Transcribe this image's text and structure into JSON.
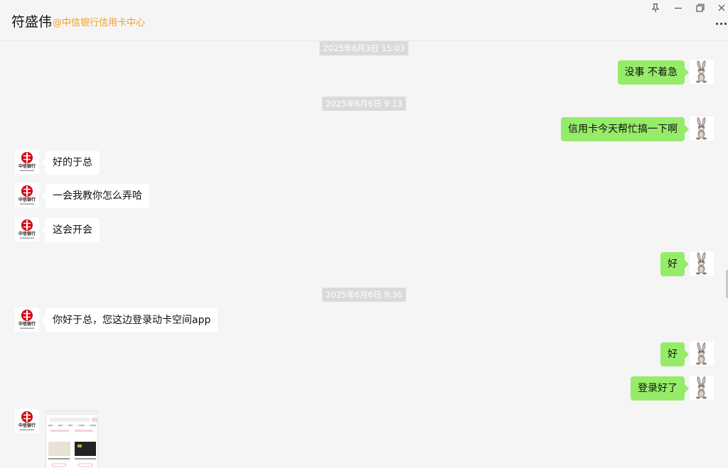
{
  "header": {
    "contact_name": "符盛伟",
    "contact_org": "@中信银行信用卡中心"
  },
  "window_controls": [
    "pin-icon",
    "minimize-icon",
    "restore-icon",
    "close-icon"
  ],
  "colors": {
    "my_bubble": "#95ec69",
    "their_bubble": "#ffffff",
    "org_label": "#f0a020",
    "bank_logo": "#d7000f"
  },
  "bank_logo": {
    "cn_text": "中信银行",
    "en_text": "CHINA CITIC BANK"
  },
  "timestamps": [
    "2025年6月3日 15:03",
    "2025年6月6日 9:13",
    "2025年6月6日 9:36"
  ],
  "messages": [
    {
      "sender": "me",
      "text": "没事 不着急"
    },
    {
      "sender": "me",
      "text": "信用卡今天帮忙搞一下啊"
    },
    {
      "sender": "them",
      "text": "好的于总"
    },
    {
      "sender": "them",
      "text": "一会我教你怎么弄哈"
    },
    {
      "sender": "them",
      "text": "这会开会"
    },
    {
      "sender": "me",
      "text": "好"
    },
    {
      "sender": "them",
      "text": "你好于总，您这边登录动卡空间app"
    },
    {
      "sender": "me",
      "text": "好"
    },
    {
      "sender": "me",
      "text": "登录好了"
    },
    {
      "sender": "them",
      "type": "image",
      "text": ""
    }
  ]
}
